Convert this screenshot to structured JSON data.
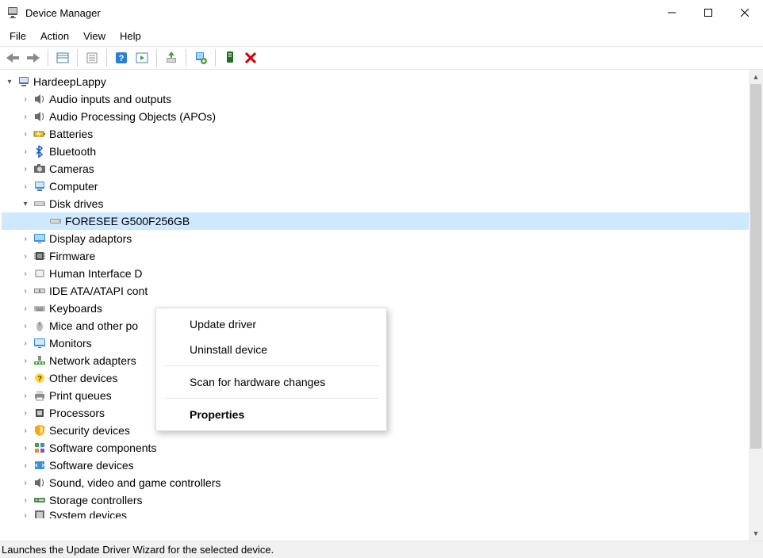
{
  "window": {
    "title": "Device Manager"
  },
  "menubar": [
    "File",
    "Action",
    "View",
    "Help"
  ],
  "toolbar_icons": [
    "back",
    "forward",
    "sep",
    "show-hidden",
    "sep",
    "properties",
    "sep",
    "help",
    "sep-wide",
    "sep",
    "update-driver",
    "sep",
    "uninstall",
    "sep",
    "scan",
    "remove"
  ],
  "tree": {
    "root": {
      "label": "HardeepLappy",
      "expanded": true
    },
    "categories": [
      {
        "label": "Audio inputs and outputs",
        "icon": "speaker",
        "expanded": false
      },
      {
        "label": "Audio Processing Objects (APOs)",
        "icon": "speaker",
        "expanded": false
      },
      {
        "label": "Batteries",
        "icon": "battery",
        "expanded": false
      },
      {
        "label": "Bluetooth",
        "icon": "bluetooth",
        "expanded": false
      },
      {
        "label": "Cameras",
        "icon": "camera",
        "expanded": false
      },
      {
        "label": "Computer",
        "icon": "computer",
        "expanded": false
      },
      {
        "label": "Disk drives",
        "icon": "disk",
        "expanded": true,
        "children": [
          {
            "label": "FORESEE G500F256GB",
            "icon": "disk",
            "selected": true
          }
        ]
      },
      {
        "label": "Display adaptors",
        "icon": "display",
        "expanded": false
      },
      {
        "label": "Firmware",
        "icon": "firmware",
        "expanded": false
      },
      {
        "label": "Human Interface Devices",
        "icon": "hid",
        "expanded": false,
        "truncated": "Human Interface D"
      },
      {
        "label": "IDE ATA/ATAPI controllers",
        "icon": "ide",
        "expanded": false,
        "truncated": "IDE ATA/ATAPI cont"
      },
      {
        "label": "Keyboards",
        "icon": "keyboard",
        "expanded": false
      },
      {
        "label": "Mice and other pointing devices",
        "icon": "mouse",
        "expanded": false,
        "truncated": "Mice and other po"
      },
      {
        "label": "Monitors",
        "icon": "monitor",
        "expanded": false
      },
      {
        "label": "Network adapters",
        "icon": "network",
        "expanded": false
      },
      {
        "label": "Other devices",
        "icon": "other",
        "expanded": false
      },
      {
        "label": "Print queues",
        "icon": "printer",
        "expanded": false
      },
      {
        "label": "Processors",
        "icon": "cpu",
        "expanded": false
      },
      {
        "label": "Security devices",
        "icon": "security",
        "expanded": false
      },
      {
        "label": "Software components",
        "icon": "component",
        "expanded": false
      },
      {
        "label": "Software devices",
        "icon": "softdev",
        "expanded": false
      },
      {
        "label": "Sound, video and game controllers",
        "icon": "speaker",
        "expanded": false
      },
      {
        "label": "Storage controllers",
        "icon": "storage",
        "expanded": false
      },
      {
        "label": "System devices",
        "icon": "system",
        "expanded": false,
        "cutoff": true
      }
    ]
  },
  "context_menu": {
    "items": [
      {
        "label": "Update driver",
        "highlighted": true
      },
      {
        "label": "Uninstall device"
      },
      {
        "sep": true
      },
      {
        "label": "Scan for hardware changes"
      },
      {
        "sep": true
      },
      {
        "label": "Properties",
        "bold": true
      }
    ]
  },
  "statusbar": {
    "text": "Launches the Update Driver Wizard for the selected device."
  }
}
